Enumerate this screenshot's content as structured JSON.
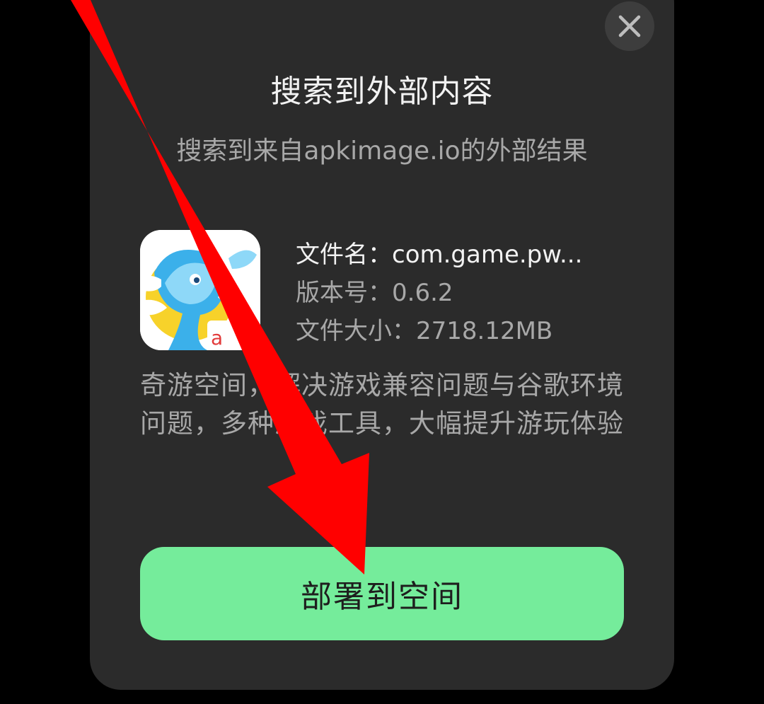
{
  "dialog": {
    "title": "搜索到外部内容",
    "subtitle": "搜索到来自apkimage.io的外部结果",
    "close_icon": "close-icon"
  },
  "file": {
    "name_label": "文件名：",
    "name_value": "com.game.pw...",
    "version_label": "版本号：",
    "version_value": "0.6.2",
    "size_label": "文件大小：",
    "size_value": "2718.12MB",
    "icon": "app-icon-blue-mascot"
  },
  "description": "奇游空间，解决游戏兼容问题与谷歌环境问题，多种游戏工具，大幅提升游玩体验",
  "actions": {
    "deploy_label": "部署到空间"
  },
  "colors": {
    "dialog_bg": "#2b2b2b",
    "button_bg": "#75ec9b",
    "arrow": "#ff0000"
  },
  "annotation": {
    "icon": "red-arrow-icon"
  }
}
